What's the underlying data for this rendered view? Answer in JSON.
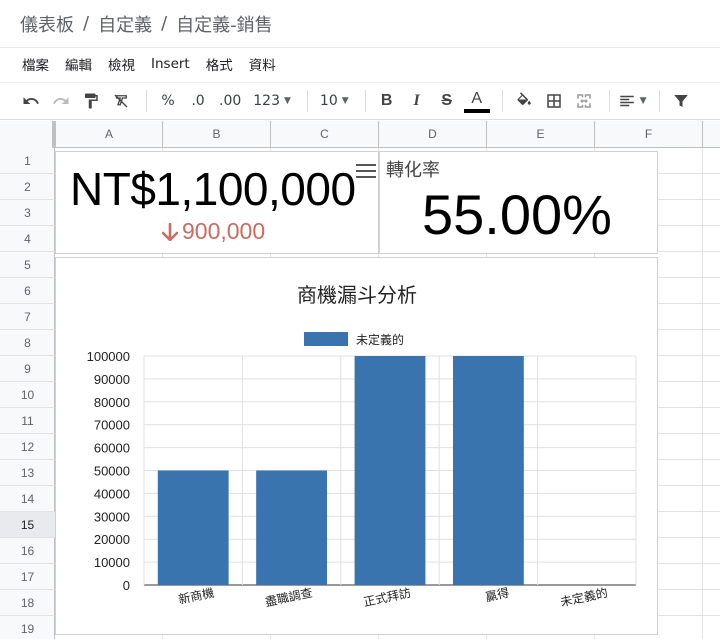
{
  "breadcrumb": [
    "儀表板",
    "自定義",
    "自定義-銷售"
  ],
  "menu": [
    "檔案",
    "編輯",
    "檢視",
    "Insert",
    "格式",
    "資料"
  ],
  "toolbar": {
    "percent": "%",
    "dec_decrease": ".0",
    "dec_increase": ".00",
    "number_format": "123",
    "font_size": "10",
    "bold": "B",
    "italic": "I",
    "strike": "S",
    "text_color": "A"
  },
  "columns": [
    "A",
    "B",
    "C",
    "D",
    "E",
    "F"
  ],
  "rows": [
    "1",
    "2",
    "3",
    "4",
    "5",
    "6",
    "7",
    "8",
    "9",
    "10",
    "11",
    "12",
    "13",
    "14",
    "15",
    "16",
    "17",
    "18",
    "19"
  ],
  "selected_row": "15",
  "scorecard_revenue": {
    "value": "NT$1,100,000",
    "delta": "900,000",
    "delta_color": "#cc6b60"
  },
  "scorecard_conversion": {
    "label": "轉化率",
    "value": "55.00%"
  },
  "chart_data": {
    "type": "bar",
    "title": "商機漏斗分析",
    "categories": [
      "新商機",
      "盡職調查",
      "正式拜訪",
      "贏得",
      "未定義的"
    ],
    "series": [
      {
        "name": "未定義的",
        "values": [
          50000,
          50000,
          100000,
          100000,
          0
        ],
        "color": "#3a74ae"
      }
    ],
    "yticks": [
      "100000",
      "90000",
      "80000",
      "70000",
      "60000",
      "50000",
      "40000",
      "30000",
      "20000",
      "10000",
      "0"
    ],
    "ylim": [
      0,
      100000
    ],
    "legend": "top",
    "grid": true
  }
}
